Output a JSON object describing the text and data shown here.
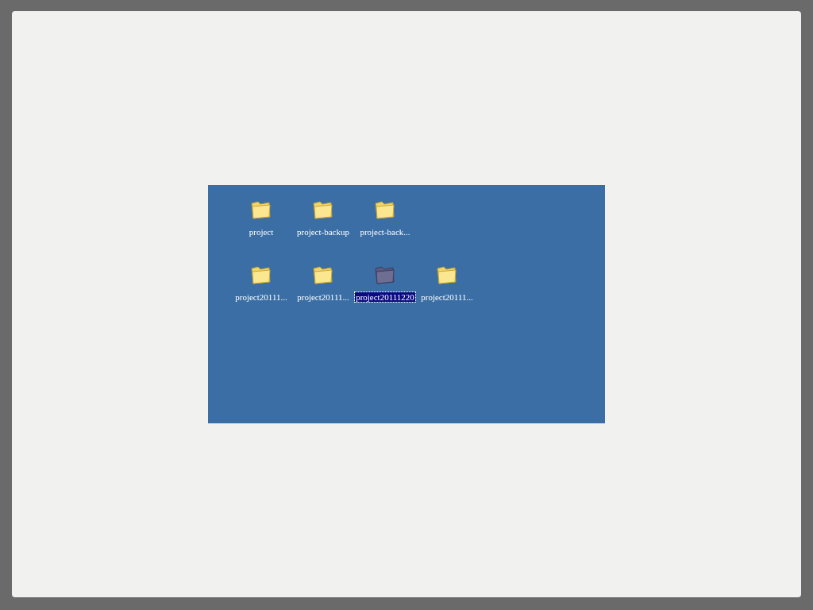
{
  "desktop": {
    "rows": [
      [
        {
          "label": "project",
          "selected": false
        },
        {
          "label": "project-backup",
          "selected": false
        },
        {
          "label": "project-back...",
          "selected": false
        }
      ],
      [
        {
          "label": "project20111...",
          "selected": false
        },
        {
          "label": "project20111...",
          "selected": false
        },
        {
          "label": "project20111220",
          "selected": true
        },
        {
          "label": "project20111...",
          "selected": false
        }
      ]
    ]
  }
}
